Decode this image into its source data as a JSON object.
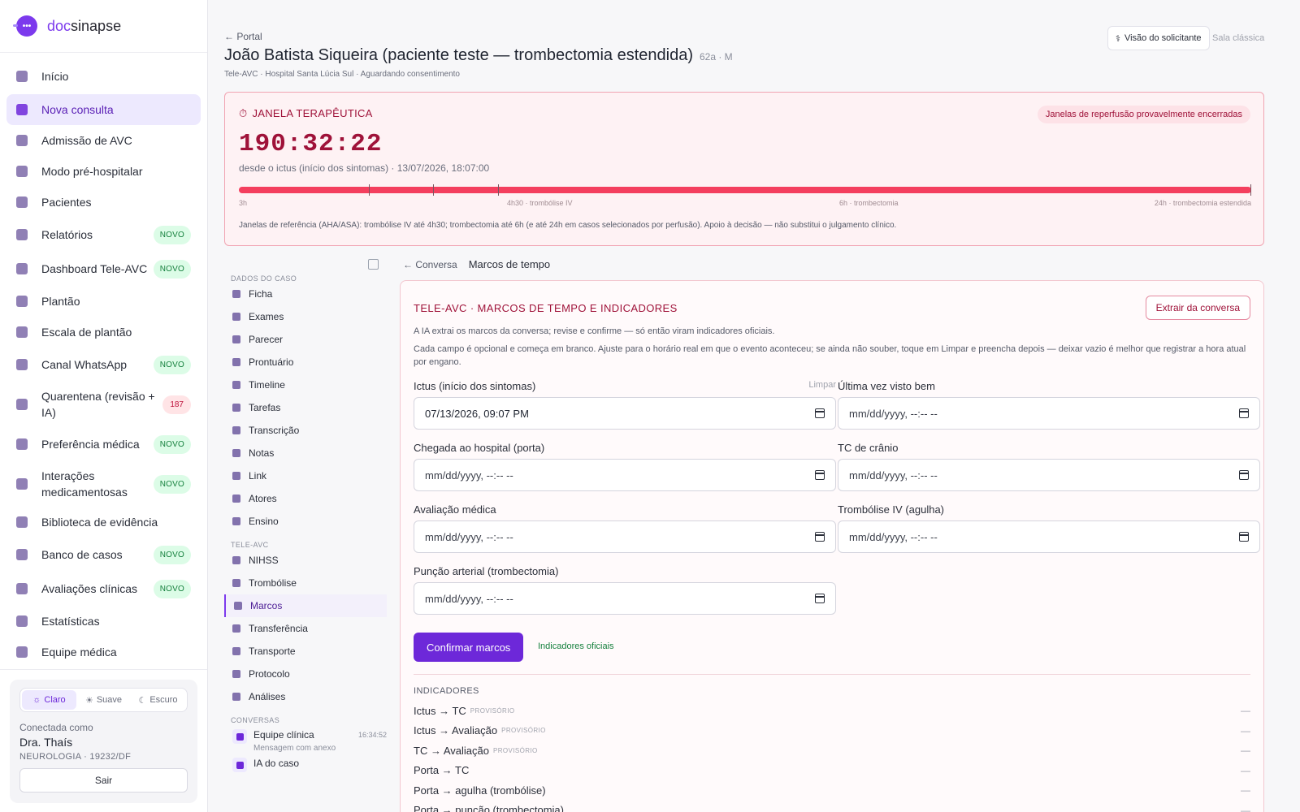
{
  "brand": {
    "name_prefix": "doc",
    "name_suffix": "sinapse"
  },
  "sidebar": {
    "items": [
      {
        "label": "Início",
        "active": false
      },
      {
        "label": "Nova consulta",
        "active": true
      },
      {
        "label": "Admissão de AVC"
      },
      {
        "label": "Modo pré-hospitalar"
      },
      {
        "label": "Pacientes"
      },
      {
        "label": "Relatórios",
        "badge": "NOVO"
      },
      {
        "label": "Dashboard Tele-AVC",
        "badge": "NOVO"
      },
      {
        "label": "Plantão"
      },
      {
        "label": "Escala de plantão"
      },
      {
        "label": "Canal WhatsApp",
        "badge": "NOVO"
      },
      {
        "label": "Quarentena (revisão + IA)",
        "count": "187"
      },
      {
        "label": "Preferência médica",
        "badge": "NOVO"
      },
      {
        "label": "Interações medicamentosas",
        "badge": "NOVO"
      },
      {
        "label": "Biblioteca de evidência"
      },
      {
        "label": "Banco de casos",
        "badge": "NOVO"
      },
      {
        "label": "Avaliações clínicas",
        "badge": "NOVO"
      },
      {
        "label": "Estatísticas"
      },
      {
        "label": "Equipe médica"
      }
    ],
    "theme": {
      "light": "Claro",
      "soft": "Suave",
      "dark": "Escuro",
      "selected": "Claro"
    },
    "user": {
      "connected_label": "Conectada como",
      "name": "Dra. Thaís",
      "spec": "NEUROLOGIA · 19232/DF",
      "logout": "Sair"
    }
  },
  "header": {
    "back": "← Portal",
    "title": "João Batista Siqueira (paciente teste — trombectomia estendida)",
    "meta": "62a · M",
    "subtitle": "Tele-AVC · Hospital Santa Lúcia Sul · Aguardando consentimento",
    "btn_visao": "Visão do solicitante",
    "btn_sala": "Sala clássica"
  },
  "janela": {
    "title": "JANELA TERAPÊUTICA",
    "pill": "Janelas de reperfusão provavelmente encerradas",
    "timer": "190:32:22",
    "since": "desde o ictus (início dos sintomas) · 13/07/2026, 18:07:00",
    "progress": 1.0,
    "ticks": {
      "t0": "3h",
      "t1": "4h30 · trombólise IV",
      "t2": "6h · trombectomia",
      "t3": "24h · trombectomia estendida"
    },
    "note": "Janelas de referência (AHA/ASA): trombólise IV até 4h30; trombectomia até 6h (e até 24h em casos selecionados por perfusão). Apoio à decisão — não substitui o julgamento clínico."
  },
  "case_nav": {
    "sec_dados": "DADOS DO CASO",
    "dados": [
      "Ficha",
      "Exames",
      "Parecer",
      "Prontuário",
      "Timeline",
      "Tarefas",
      "Transcrição",
      "Notas",
      "Link",
      "Atores",
      "Ensino"
    ],
    "sec_tele": "TELE-AVC",
    "tele": [
      "NIHSS",
      "Trombólise",
      "Marcos",
      "Transferência",
      "Transporte",
      "Protocolo",
      "Análises"
    ],
    "active": "Marcos",
    "sec_conv": "CONVERSAS",
    "conversas": [
      {
        "title": "Equipe clínica",
        "sub": "Mensagem com anexo",
        "time": "16:34:52"
      },
      {
        "title": "IA do caso",
        "sub": "",
        "time": ""
      }
    ]
  },
  "content": {
    "crumb_back": "← Conversa",
    "crumb_current": "Marcos de tempo",
    "card_title": "TELE-AVC · MARCOS DE TEMPO E INDICADORES",
    "btn_extrair": "Extrair da conversa",
    "p1": "A IA extrai os marcos da conversa; revise e confirme — só então viram indicadores oficiais.",
    "p2": "Cada campo é opcional e começa em branco. Ajuste para o horário real em que o evento aconteceu; se ainda não souber, toque em Limpar e preencha depois — deixar vazio é melhor que registrar a hora atual por engano.",
    "fields": {
      "ictus": {
        "label": "Ictus (início dos sintomas)",
        "clear": "Limpar",
        "value": "07/13/2026, 09:07 PM"
      },
      "lkw": {
        "label": "Última vez visto bem",
        "value": "mm/dd/yyyy, --:-- --"
      },
      "porta": {
        "label": "Chegada ao hospital (porta)",
        "value": "mm/dd/yyyy, --:-- --"
      },
      "tc": {
        "label": "TC de crânio",
        "value": "mm/dd/yyyy, --:-- --"
      },
      "aval": {
        "label": "Avaliação médica",
        "value": "mm/dd/yyyy, --:-- --"
      },
      "trombolise": {
        "label": "Trombólise IV (agulha)",
        "value": "mm/dd/yyyy, --:-- --"
      },
      "puncao": {
        "label": "Punção arterial (trombectomia)",
        "value": "mm/dd/yyyy, --:-- --"
      }
    },
    "btn_confirm": "Confirmar marcos",
    "link_ind": "Indicadores oficiais",
    "ind_title": "INDICADORES",
    "indicadores": [
      {
        "label": "Ictus → TC",
        "tag": "PROVISÓRIO",
        "value": "—"
      },
      {
        "label": "Ictus → Avaliação",
        "tag": "PROVISÓRIO",
        "value": "—"
      },
      {
        "label": "TC → Avaliação",
        "tag": "PROVISÓRIO",
        "value": "—"
      },
      {
        "label": "Porta → TC",
        "tag": "",
        "value": "—"
      },
      {
        "label": "Porta → agulha (trombólise)",
        "tag": "",
        "value": "—"
      },
      {
        "label": "Porta → punção (trombectomia)",
        "tag": "",
        "value": "—"
      }
    ]
  }
}
